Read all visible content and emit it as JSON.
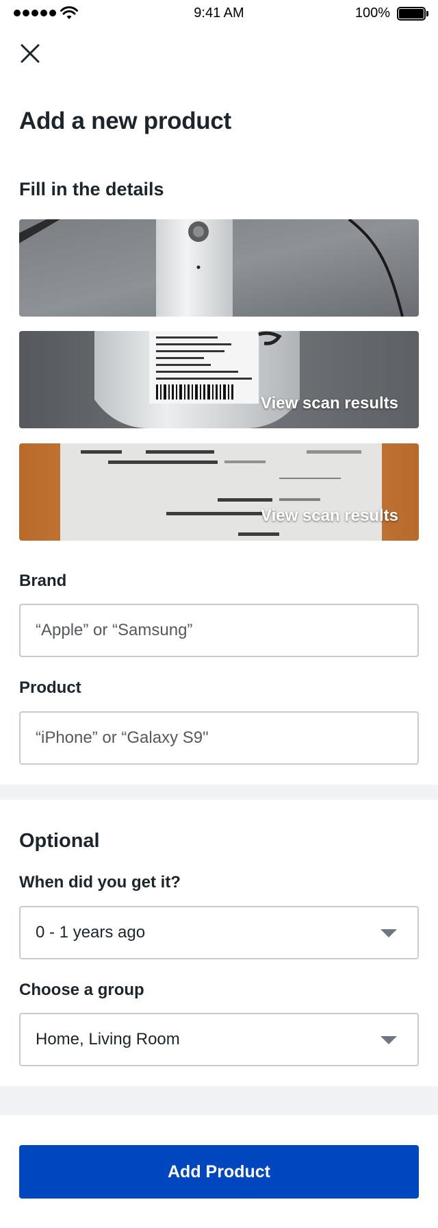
{
  "status_bar": {
    "time": "9:41 AM",
    "battery": "100%"
  },
  "header": {
    "title": "Add a new product",
    "subtitle": "Fill in the details"
  },
  "photos": [
    {
      "scan_label": ""
    },
    {
      "scan_label": "View scan results"
    },
    {
      "scan_label": "View scan results"
    }
  ],
  "brand": {
    "label": "Brand",
    "placeholder": "“Apple” or “Samsung”"
  },
  "product": {
    "label": "Product",
    "placeholder": "“iPhone” or “Galaxy S9\""
  },
  "optional": {
    "title": "Optional",
    "when": {
      "label": "When did you get it?",
      "value": "0 - 1 years ago"
    },
    "group": {
      "label": "Choose a group",
      "value": "Home, Living Room"
    }
  },
  "add_button": {
    "label": "Add Product"
  },
  "colors": {
    "accent": "#0046be",
    "border": "#c5cbd5",
    "band": "#f0f2f4"
  }
}
